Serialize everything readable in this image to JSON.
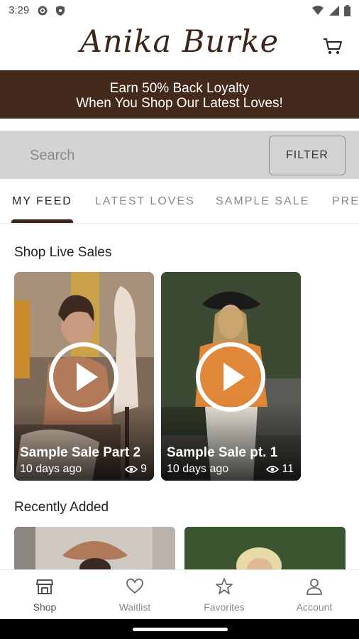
{
  "status_bar": {
    "time": "3:29"
  },
  "header": {
    "brand": "Anika Burke"
  },
  "promo": {
    "line1": "Earn 50% Back Loyalty",
    "line2": "When You Shop Our Latest Loves!"
  },
  "search": {
    "placeholder": "Search",
    "filter_label": "FILTER"
  },
  "tabs": [
    {
      "label": "MY FEED",
      "active": true
    },
    {
      "label": "LATEST LOVES"
    },
    {
      "label": "SAMPLE SALE"
    },
    {
      "label": "PRE"
    }
  ],
  "live_sales": {
    "title": "Shop Live Sales",
    "cards": [
      {
        "title": "Sample Sale Part 2",
        "date": "10 days ago",
        "views": "9"
      },
      {
        "title": "Sample Sale pt. 1",
        "date": "10 days ago",
        "views": "11"
      }
    ]
  },
  "recently_added": {
    "title": "Recently Added"
  },
  "bottom_nav": [
    {
      "label": "Shop",
      "icon": "shop-icon",
      "active": true
    },
    {
      "label": "Waitlist",
      "icon": "heart-icon"
    },
    {
      "label": "Favorites",
      "icon": "star-icon"
    },
    {
      "label": "Account",
      "icon": "person-icon"
    }
  ],
  "colors": {
    "brand_brown": "#44291d",
    "search_bg": "#d3d3d3"
  }
}
